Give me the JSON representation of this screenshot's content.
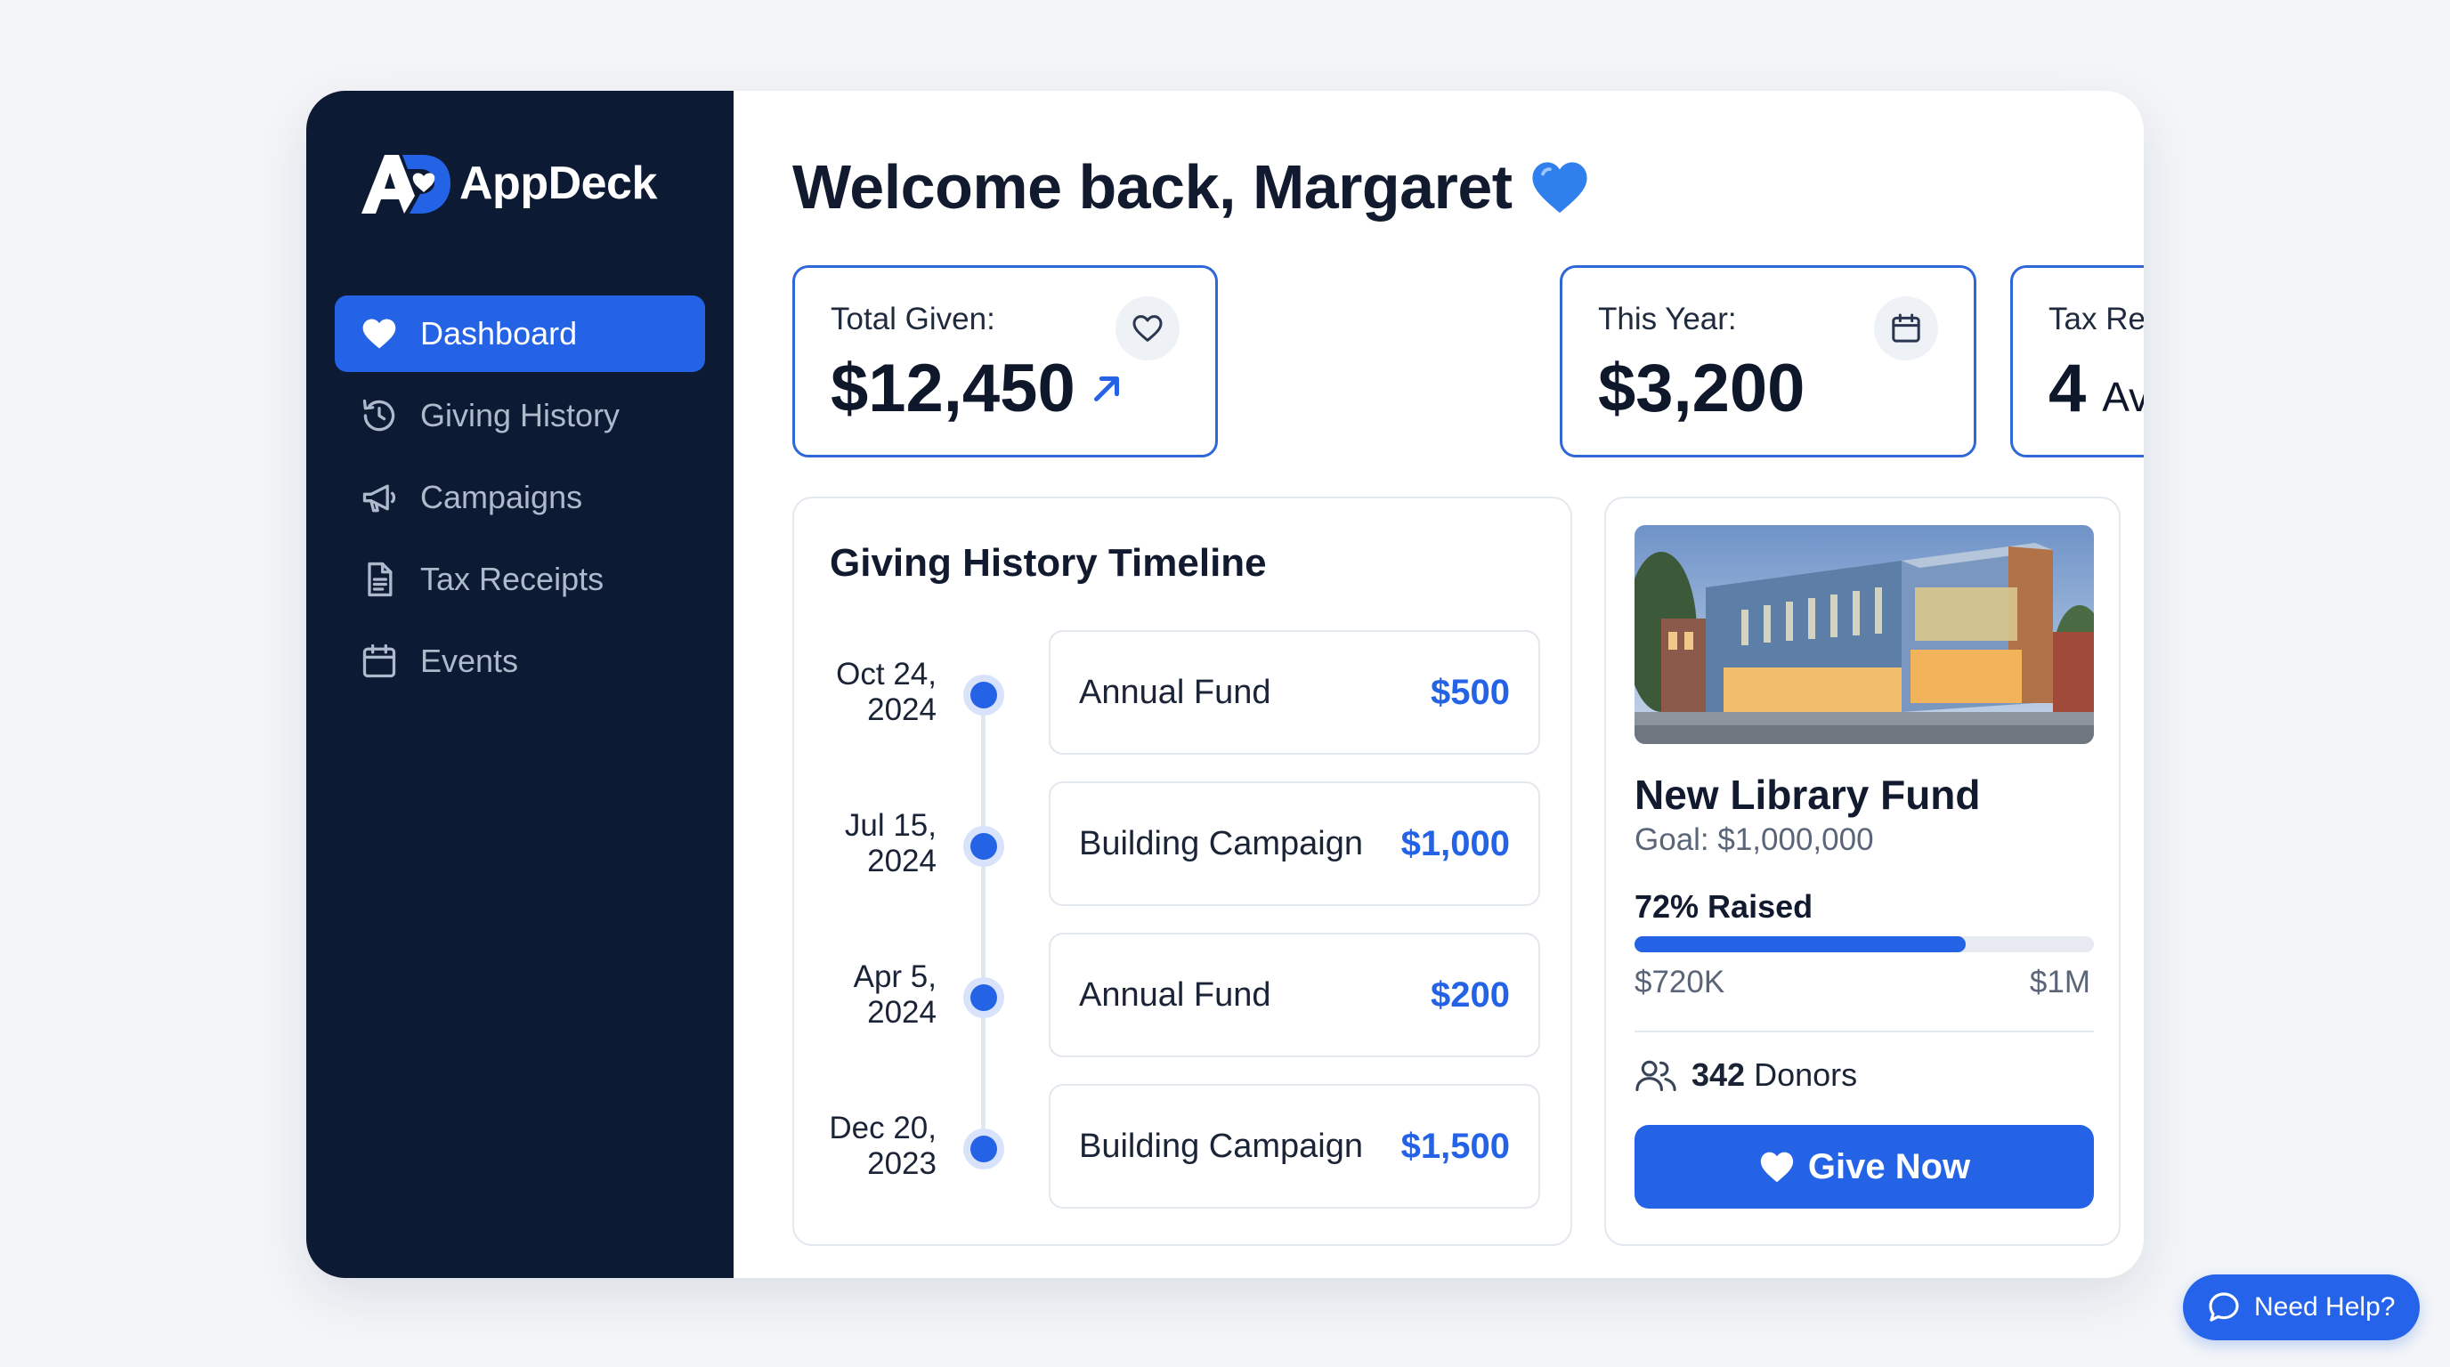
{
  "app": {
    "name": "AppDeck"
  },
  "sidebar": {
    "items": [
      {
        "label": "Dashboard",
        "icon": "heart-icon",
        "active": true
      },
      {
        "label": "Giving History",
        "icon": "history-icon"
      },
      {
        "label": "Campaigns",
        "icon": "megaphone-icon"
      },
      {
        "label": "Tax Receipts",
        "icon": "document-icon"
      },
      {
        "label": "Events",
        "icon": "calendar-icon"
      }
    ]
  },
  "header": {
    "welcome": "Welcome back, Margaret",
    "emoji_icon": "blue-heart-icon"
  },
  "stats": [
    {
      "label": "Total Given:",
      "value": "$12,450",
      "icon": "heart-outline-icon",
      "trend_icon": "arrow-up-right-icon"
    },
    {
      "label": "This Year:",
      "value": "$3,200",
      "icon": "calendar-icon"
    },
    {
      "label": "Tax Receipts:",
      "value": "4",
      "unit": "Available",
      "icon": "document-icon"
    }
  ],
  "timeline": {
    "title": "Giving History Timeline",
    "entries": [
      {
        "date_line1": "Oct 24,",
        "date_line2": "2024",
        "fund": "Annual Fund",
        "amount": "$500"
      },
      {
        "date_line1": "Jul 15,",
        "date_line2": "2024",
        "fund": "Building Campaign",
        "amount": "$1,000"
      },
      {
        "date_line1": "Apr 5,",
        "date_line2": "2024",
        "fund": "Annual Fund",
        "amount": "$200"
      },
      {
        "date_line1": "Dec 20,",
        "date_line2": "2023",
        "fund": "Building Campaign",
        "amount": "$1,500"
      }
    ]
  },
  "campaign": {
    "title": "New Library Fund",
    "goal": "Goal: $1,000,000",
    "raised_label": "72% Raised",
    "raised_fraction": 0.72,
    "raised_amount": "$720K",
    "goal_short": "$1M",
    "donor_count": "342",
    "donor_label": "Donors",
    "cta": "Give Now"
  },
  "help": {
    "label": "Need Help?"
  },
  "colors": {
    "primary": "#2463e6",
    "sidebar_bg": "#0c1a33",
    "page_bg": "#f3f5f8"
  }
}
